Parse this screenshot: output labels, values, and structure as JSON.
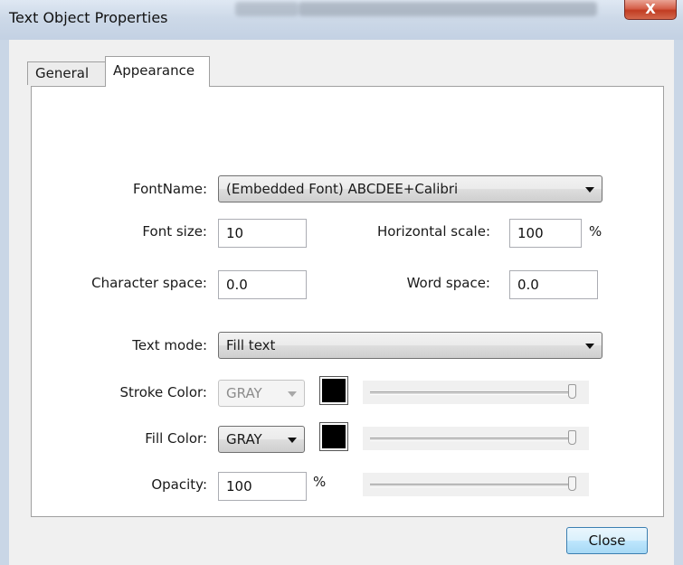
{
  "window": {
    "title": "Text Object Properties",
    "close_glyph": "X"
  },
  "tabs": [
    {
      "label": "General",
      "selected": false
    },
    {
      "label": "Appearance",
      "selected": true
    }
  ],
  "form": {
    "fontname_label": "FontName:",
    "fontname_value": "(Embedded Font) ABCDEE+Calibri",
    "fontsize_label": "Font size:",
    "fontsize_value": "10",
    "hscale_label": "Horizontal scale:",
    "hscale_value": "100",
    "hscale_unit": "%",
    "charspace_label": "Character space:",
    "charspace_value": "0.0",
    "wordspace_label": "Word space:",
    "wordspace_value": "0.0",
    "textmode_label": "Text mode:",
    "textmode_value": "Fill text",
    "stroke_label": "Stroke Color:",
    "stroke_mode": "GRAY",
    "stroke_enabled": false,
    "stroke_color": "#000000",
    "stroke_level": 1.0,
    "fill_label": "Fill Color:",
    "fill_mode": "GRAY",
    "fill_color": "#000000",
    "fill_level": 1.0,
    "opacity_label": "Opacity:",
    "opacity_value": "100",
    "opacity_unit": "%",
    "opacity_level": 1.0
  },
  "footer": {
    "close_label": "Close"
  },
  "colors": {
    "accent": "#3c7fb1",
    "title_close": "#c13c22"
  },
  "icons": {
    "dropdown": "chevron-down-icon",
    "close": "close-icon"
  }
}
